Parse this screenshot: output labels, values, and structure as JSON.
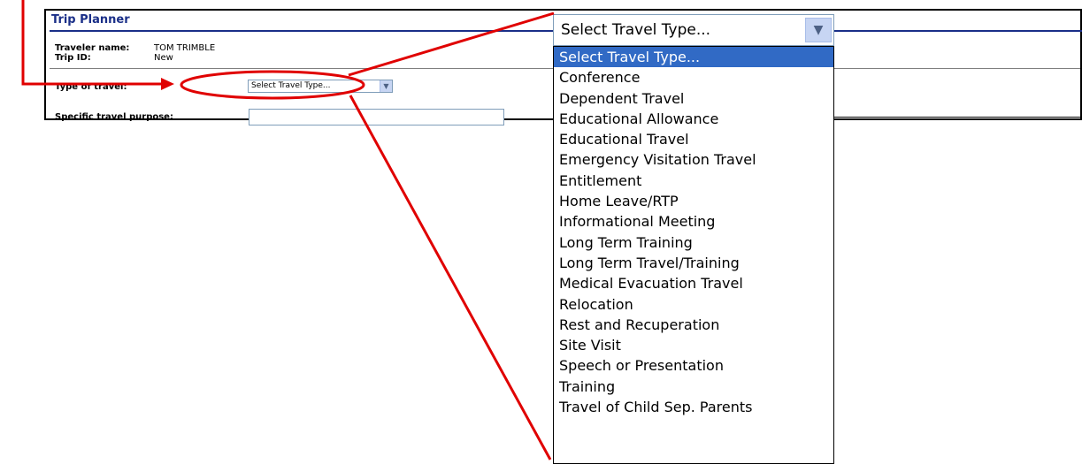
{
  "form": {
    "title": "Trip Planner",
    "traveler_label": "Traveler name:",
    "traveler_value": "TOM TRIMBLE",
    "tripid_label": "Trip ID:",
    "tripid_value": "New",
    "type_label": "Type of travel:",
    "type_selected": "Select Travel Type...",
    "purpose_label": "Specific travel purpose:",
    "purpose_value": ""
  },
  "zoomed_select": {
    "selected": "Select Travel Type...",
    "options": [
      "Select Travel Type...",
      "Conference",
      "Dependent Travel",
      "Educational Allowance",
      "Educational Travel",
      "Emergency Visitation Travel",
      "Entitlement",
      "Home Leave/RTP",
      "Informational Meeting",
      "Long Term Training",
      "Long Term Travel/Training",
      "Medical Evacuation Travel",
      "Relocation",
      "Rest and Recuperation",
      "Site Visit",
      "Speech or Presentation",
      "Training",
      "Travel of Child Sep. Parents"
    ]
  },
  "icons": {
    "dropdown": "chevron-down-icon",
    "pointer": "arrow-right-icon"
  },
  "colors": {
    "annotation": "#e00000",
    "title": "#1a2f88",
    "highlight": "#316ac5"
  }
}
